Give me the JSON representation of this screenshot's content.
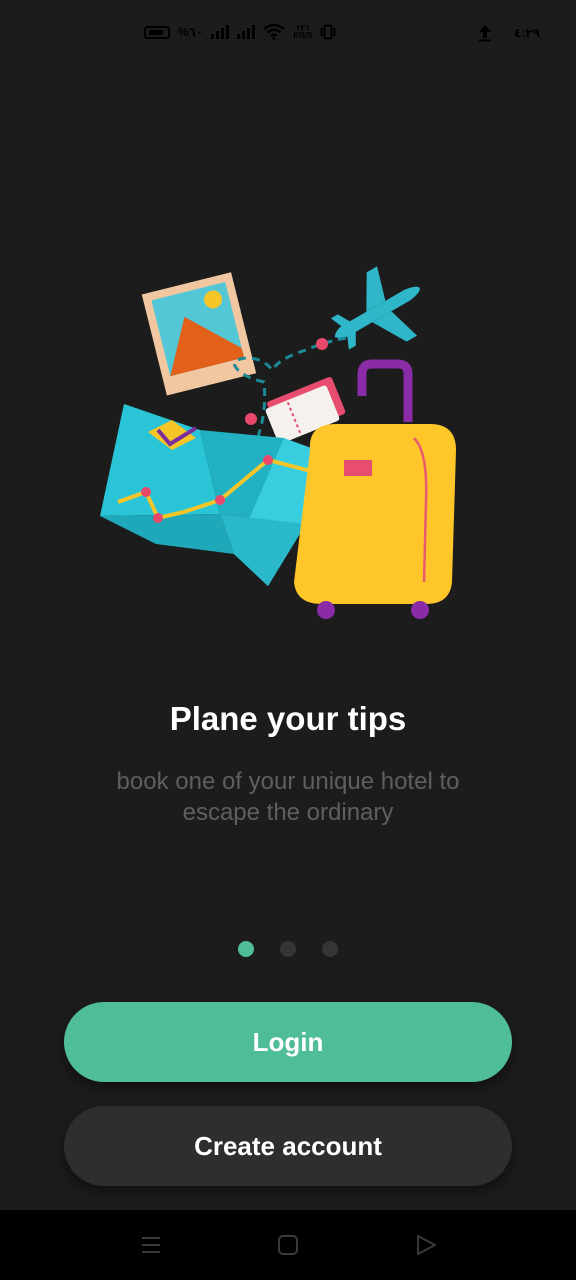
{
  "status_bar": {
    "battery_percent": "%٦٠",
    "net_speed_value": "١٢١",
    "net_speed_unit": "KB/S",
    "clock": "٤:٢٩",
    "icons": [
      "battery-icon",
      "signal-icon",
      "wifi-icon",
      "vibrate-icon",
      "upload-icon"
    ]
  },
  "onboarding": {
    "title": "Plane your tips",
    "subtitle": "book one of your unique hotel to escape the ordinary",
    "pager": {
      "total": 3,
      "active": 0
    },
    "colors": {
      "accent": "#4fbd9a",
      "background": "#1c1c1c",
      "secondary_button": "#2e2e2e",
      "subtitle": "#5f5f5f"
    }
  },
  "actions": {
    "login_label": "Login",
    "create_account_label": "Create account"
  },
  "nav_bar": {
    "icons": [
      "menu-icon",
      "home-square-icon",
      "back-triangle-icon"
    ]
  }
}
